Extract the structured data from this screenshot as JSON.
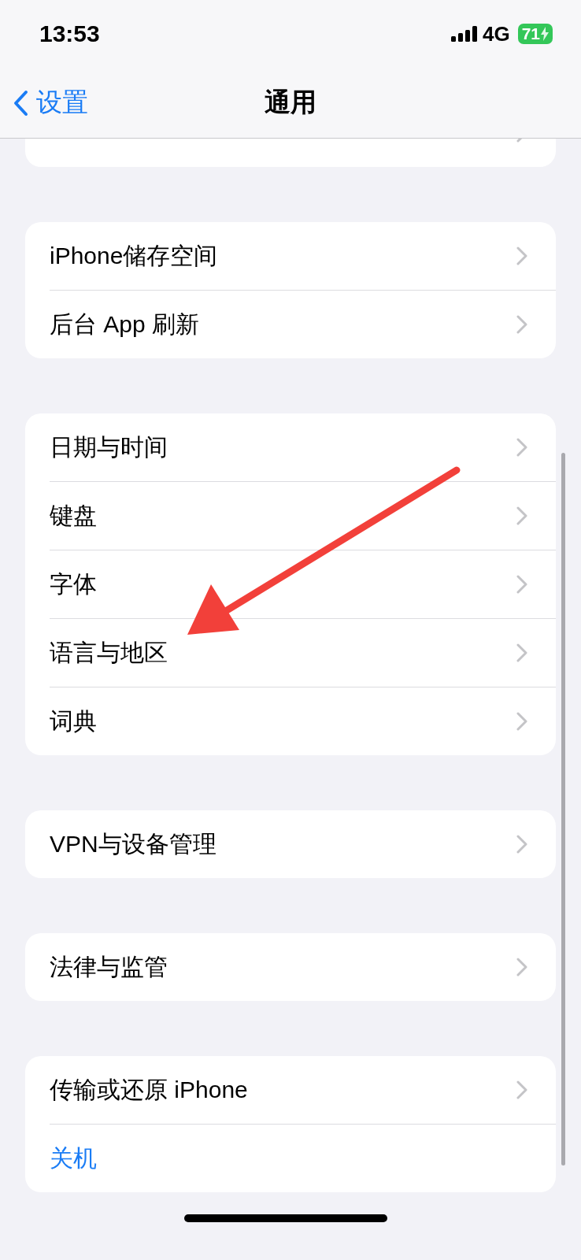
{
  "status_bar": {
    "time": "13:53",
    "network": "4G",
    "battery": "71",
    "charging": true
  },
  "nav": {
    "back_label": "设置",
    "title": "通用"
  },
  "groups": [
    {
      "cut_off": true,
      "items": [
        {
          "kind": "link"
        }
      ]
    },
    {
      "cut_off": false,
      "items": [
        {
          "label": "iPhone储存空间",
          "kind": "link"
        },
        {
          "label": "后台 App 刷新",
          "kind": "link"
        }
      ]
    },
    {
      "cut_off": false,
      "items": [
        {
          "label": "日期与时间",
          "kind": "link"
        },
        {
          "label": "键盘",
          "kind": "link"
        },
        {
          "label": "字体",
          "kind": "link"
        },
        {
          "label": "语言与地区",
          "kind": "link"
        },
        {
          "label": "词典",
          "kind": "link"
        }
      ]
    },
    {
      "cut_off": false,
      "items": [
        {
          "label": "VPN与设备管理",
          "kind": "link"
        }
      ]
    },
    {
      "cut_off": false,
      "items": [
        {
          "label": "法律与监管",
          "kind": "link"
        }
      ]
    },
    {
      "cut_off": false,
      "items": [
        {
          "label": "传输或还原 iPhone",
          "kind": "link"
        },
        {
          "label": "关机",
          "kind": "action"
        }
      ]
    }
  ],
  "annotation": {
    "kind": "arrow"
  }
}
